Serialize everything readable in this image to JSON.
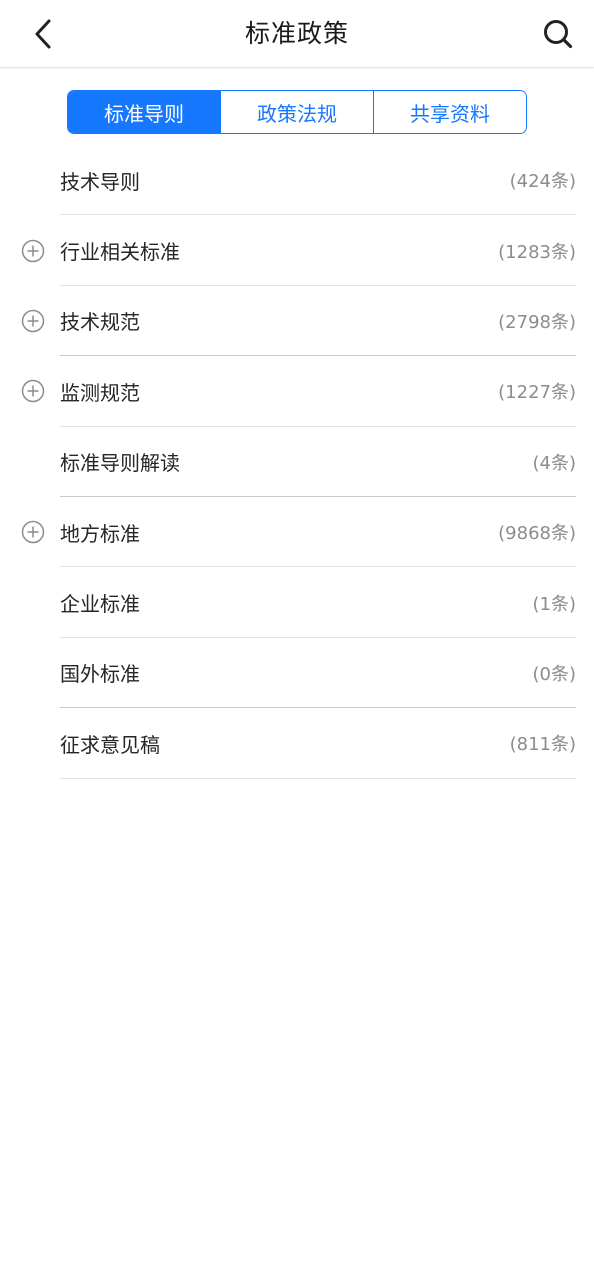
{
  "header": {
    "title": "标准政策",
    "back_icon": "chevron-left-icon",
    "search_icon": "search-icon"
  },
  "tabs": [
    {
      "label": "标准导则",
      "active": true
    },
    {
      "label": "政策法规",
      "active": false
    },
    {
      "label": "共享资料",
      "active": false
    }
  ],
  "colors": {
    "accent": "#1677ff",
    "text": "#262626",
    "count": "#8c8c8c",
    "divider": "#e3e3e3"
  },
  "items": [
    {
      "label": "技术导则",
      "count": "(424条)",
      "expandable": false
    },
    {
      "label": "行业相关标准",
      "count": "(1283条)",
      "expandable": true
    },
    {
      "label": "技术规范",
      "count": "(2798条)",
      "expandable": true
    },
    {
      "label": "监测规范",
      "count": "(1227条)",
      "expandable": true
    },
    {
      "label": "标准导则解读",
      "count": "(4条)",
      "expandable": false
    },
    {
      "label": "地方标准",
      "count": "(9868条)",
      "expandable": true
    },
    {
      "label": "企业标准",
      "count": "(1条)",
      "expandable": false
    },
    {
      "label": "国外标准",
      "count": "(0条)",
      "expandable": false
    },
    {
      "label": "征求意见稿",
      "count": "(811条)",
      "expandable": false
    }
  ]
}
